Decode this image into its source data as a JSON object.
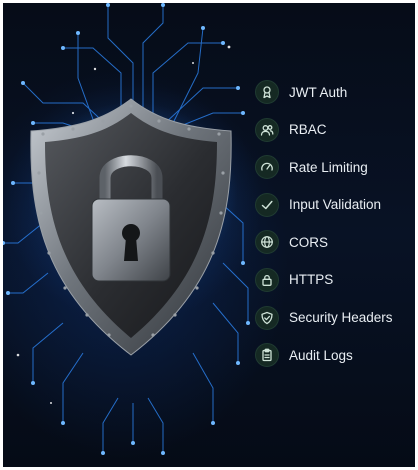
{
  "features": {
    "items": [
      {
        "label": "JWT Auth",
        "icon": "badge-icon"
      },
      {
        "label": "RBAC",
        "icon": "users-icon"
      },
      {
        "label": "Rate Limiting",
        "icon": "gauge-icon"
      },
      {
        "label": "Input Validation",
        "icon": "check-icon"
      },
      {
        "label": "CORS",
        "icon": "globe-icon"
      },
      {
        "label": "HTTPS",
        "icon": "lock-icon"
      },
      {
        "label": "Security Headers",
        "icon": "shield-check-icon"
      },
      {
        "label": "Audit Logs",
        "icon": "clipboard-icon"
      }
    ]
  },
  "colors": {
    "background": "#07101f",
    "circuit_glow": "#2f8cff",
    "icon_badge": "#152923",
    "icon_stroke": "#cfe3d8",
    "label_text": "#e9eef3"
  }
}
